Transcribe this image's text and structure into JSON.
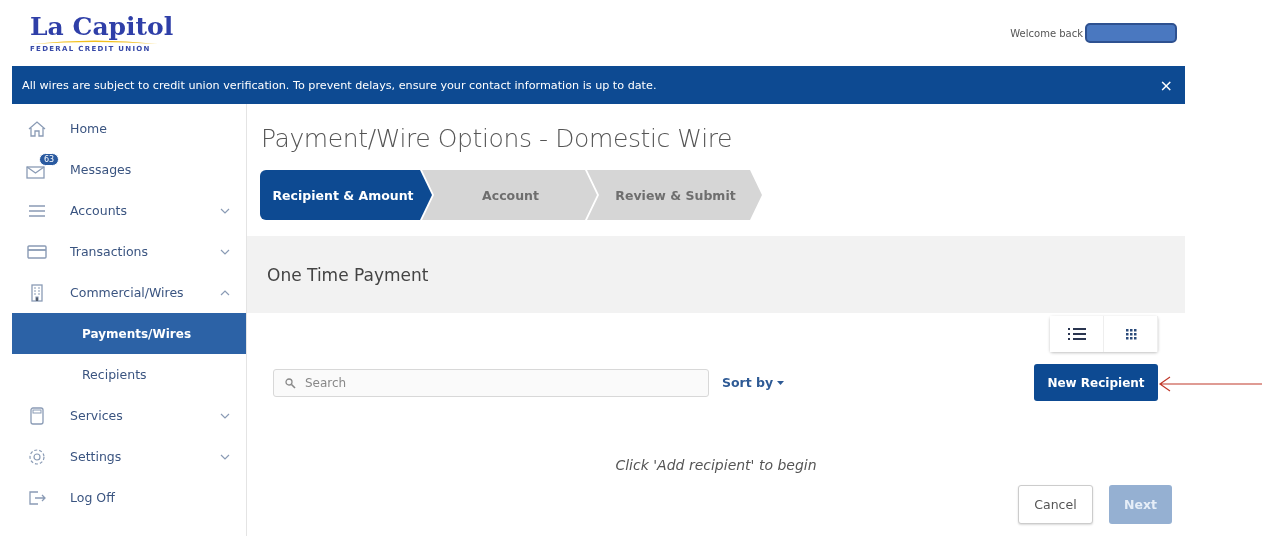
{
  "header": {
    "logo": {
      "name": "La Capitol",
      "tagline": "FEDERAL CREDIT UNION"
    },
    "welcome": "Welcome back"
  },
  "banner": {
    "message": "All wires are subject to credit union verification. To prevent delays, ensure your contact information is up to date.",
    "close": "×"
  },
  "sidebar": {
    "items": [
      {
        "label": "Home",
        "kind": "link",
        "selected": false
      },
      {
        "label": "Messages",
        "kind": "link",
        "selected": false,
        "badge": "63"
      },
      {
        "label": "Accounts",
        "kind": "group",
        "selected": false,
        "expanded": false
      },
      {
        "label": "Transactions",
        "kind": "group",
        "selected": false,
        "expanded": false
      },
      {
        "label": "Commercial/Wires",
        "kind": "group",
        "selected": false,
        "expanded": true,
        "children": [
          {
            "label": "Payments/Wires",
            "selected": true
          },
          {
            "label": "Recipients",
            "selected": false
          }
        ]
      },
      {
        "label": "Services",
        "kind": "group",
        "selected": false,
        "expanded": false
      },
      {
        "label": "Settings",
        "kind": "group",
        "selected": false,
        "expanded": false
      },
      {
        "label": "Log Off",
        "kind": "link",
        "selected": false
      }
    ]
  },
  "page": {
    "title": "Payment/Wire Options - Domestic Wire",
    "steps": [
      {
        "label": "Recipient & Amount",
        "selected": true
      },
      {
        "label": "Account",
        "selected": false
      },
      {
        "label": "Review & Submit",
        "selected": false
      }
    ],
    "section_title": "One Time Payment",
    "search": {
      "placeholder": "Search"
    },
    "sort": "Sort by",
    "new_button": "New Recipient",
    "empty_message": "Click 'Add recipient' to begin",
    "buttons": [
      {
        "label": "Cancel",
        "kind": "secondary",
        "disabled": false
      },
      {
        "label": "Next",
        "kind": "primary",
        "disabled": true
      }
    ]
  }
}
